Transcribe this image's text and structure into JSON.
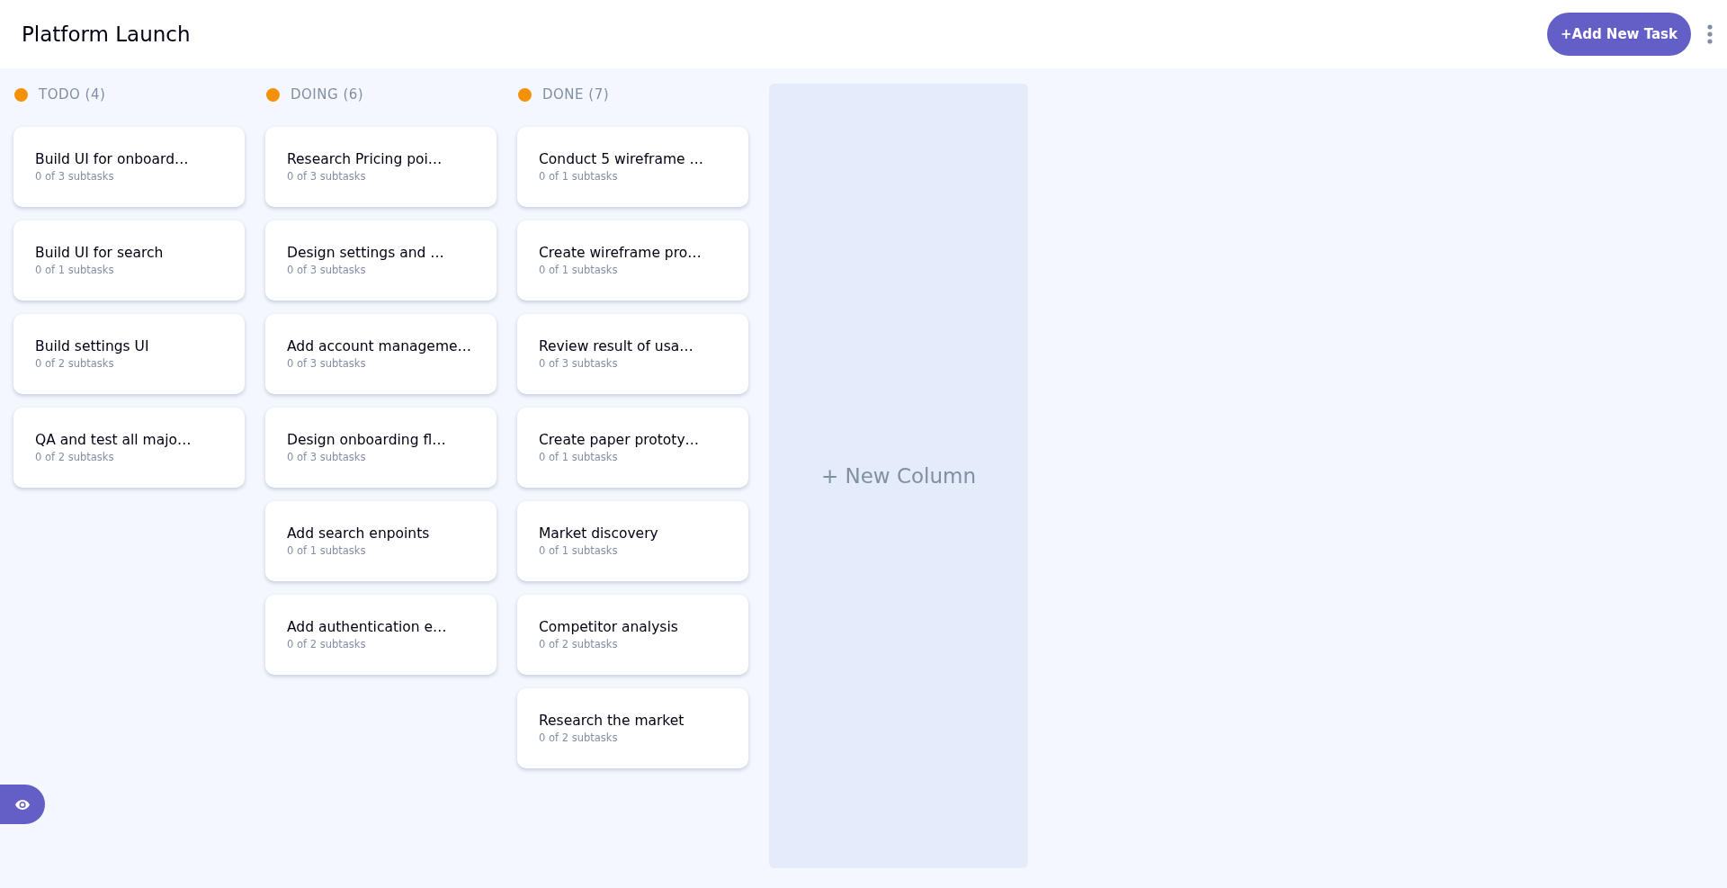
{
  "header": {
    "title": "Platform Launch",
    "add_task_button": "+Add New Task"
  },
  "columns": [
    {
      "name": "TODO (4)",
      "color": "#f59106",
      "tasks": [
        {
          "title": "Build UI for onboard…",
          "subtasks": "0 of 3 subtasks"
        },
        {
          "title": "Build UI for search",
          "subtasks": "0 of 1 subtasks"
        },
        {
          "title": "Build settings UI",
          "subtasks": "0 of 2 subtasks"
        },
        {
          "title": "QA and test all majo…",
          "subtasks": "0 of 2 subtasks"
        }
      ]
    },
    {
      "name": "DOING (6)",
      "color": "#f59106",
      "tasks": [
        {
          "title": "Research Pricing poi…",
          "subtasks": "0 of 3 subtasks"
        },
        {
          "title": "Design settings and …",
          "subtasks": "0 of 3 subtasks"
        },
        {
          "title": "Add account manageme…",
          "subtasks": "0 of 3 subtasks"
        },
        {
          "title": "Design onboarding fl…",
          "subtasks": "0 of 3 subtasks"
        },
        {
          "title": "Add search enpoints",
          "subtasks": "0 of 1 subtasks"
        },
        {
          "title": "Add authentication e…",
          "subtasks": "0 of 2 subtasks"
        }
      ]
    },
    {
      "name": "DONE (7)",
      "color": "#f59106",
      "tasks": [
        {
          "title": "Conduct 5 wireframe …",
          "subtasks": "0 of 1 subtasks"
        },
        {
          "title": "Create wireframe pro…",
          "subtasks": "0 of 1 subtasks"
        },
        {
          "title": "Review result of usa…",
          "subtasks": "0 of 3 subtasks"
        },
        {
          "title": "Create paper prototy…",
          "subtasks": "0 of 1 subtasks"
        },
        {
          "title": "Market discovery",
          "subtasks": "0 of 1 subtasks"
        },
        {
          "title": "Competitor analysis",
          "subtasks": "0 of 2 subtasks"
        },
        {
          "title": "Research the market",
          "subtasks": "0 of 2 subtasks"
        }
      ]
    }
  ],
  "new_column": "+ New Column"
}
